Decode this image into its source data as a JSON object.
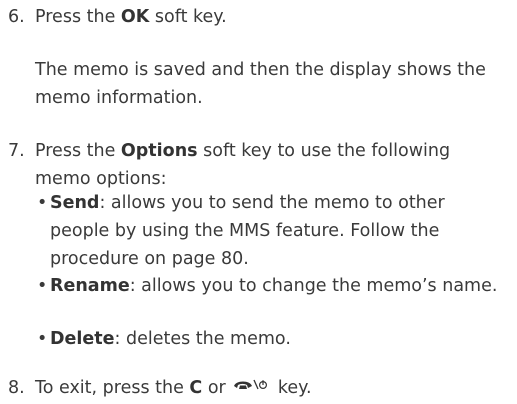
{
  "steps": {
    "s6": {
      "number": "6.",
      "pre": "Press the ",
      "key": "OK",
      "post": " soft key."
    },
    "s6_note": "The memo is saved and then the display shows the memo information.",
    "s7": {
      "number": "7.",
      "pre": "Press the ",
      "key": "Options",
      "post": " soft key to use the following memo options:"
    },
    "bullets": [
      {
        "term": "Send",
        "text": ": allows you to send the memo to other people by using the MMS feature. Follow the procedure on page 80."
      },
      {
        "term": "Rename",
        "text": ": allows you to change the memo’s name."
      },
      {
        "term": "Delete",
        "text": ": deletes the memo."
      }
    ],
    "s8": {
      "number": "8.",
      "pre": "To exit, press the ",
      "key": "C",
      "mid": " or ",
      "icon": "end-call-power-icon",
      "post": " key."
    }
  },
  "bullet_char": "•"
}
